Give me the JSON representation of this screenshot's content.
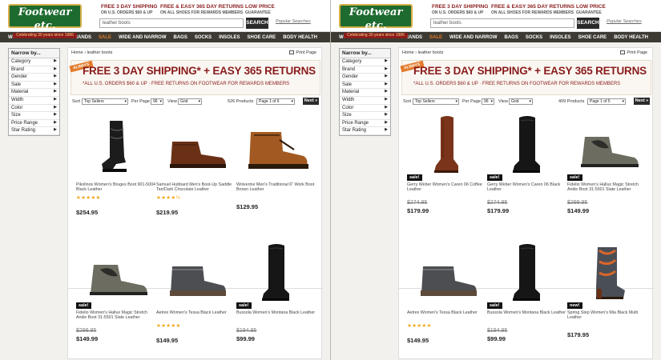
{
  "header": {
    "logo_text": "Footwear etc.",
    "logo_tagline": "Celebrating 30 years since 1986",
    "promos": [
      {
        "line1": "FREE 3 DAY SHIPPING",
        "line2": "ON U.S. ORDERS $60 & UP"
      },
      {
        "line1": "FREE & EASY 365 DAY RETURNS",
        "line2": "ON ALL SHOES FOR REWARDS MEMBERS"
      },
      {
        "line1": "LOW PRICE",
        "line2": "GUARANTEE"
      }
    ],
    "search_value": "leather boots",
    "search_button": "SEARCH",
    "popular_searches": "Popular Searches"
  },
  "nav": [
    "WOMEN",
    "MEN",
    "KIDS",
    "BRANDS",
    "SALE",
    "WIDE AND NARROW",
    "BAGS",
    "SOCKS",
    "INSOLES",
    "SHOE CARE",
    "BODY HEALTH"
  ],
  "sidebar": {
    "heading": "Narrow by...",
    "items": [
      "Category",
      "Brand",
      "Gender",
      "Sale",
      "Material",
      "Width",
      "Color",
      "Size",
      "Price Range",
      "Star Rating"
    ]
  },
  "crumbs": {
    "home": "Home",
    "current": "leather boots",
    "print": "Print Page"
  },
  "banner": {
    "badge": "ALWAYS",
    "main": "FREE 3 DAY SHIPPING* + EASY 365 RETURNS",
    "sub": "*ALL U.S. ORDERS $60 & UP · FREE RETURNS ON FOOTWEAR FOR REWARDS MEMBERS"
  },
  "sort_labels": {
    "sort": "Sort",
    "per_page": "Per Page",
    "view": "View",
    "next": "Next »"
  },
  "left": {
    "sort": "Top Sellers",
    "per_page": "96",
    "view": "Grid",
    "count": "526 Products",
    "page": "Page 1 of 6",
    "products": [
      {
        "name": "Pikolinos Women's Bruges Boot 901-5004 Black Leather",
        "stars": "★★★★★",
        "price": "$254.95",
        "was": "",
        "badge": "",
        "shoe": "tall-black"
      },
      {
        "name": "Samuel Hubbard Men's Boot-Up Saddle Tan/Dark Chocolate Leather",
        "stars": "★★★★½",
        "price": "$219.95",
        "was": "",
        "badge": "",
        "shoe": "chukka-brown"
      },
      {
        "name": "Wolverine Men's Traditional 6\" Work Boot Brown Leather",
        "stars": "",
        "price": "$129.95",
        "was": "",
        "badge": "",
        "shoe": "work-brown"
      },
      {
        "name": "Fidelio Women's Hallux Magic Stretch Ankle Boot 31-5501 Slate Leather",
        "stars": "",
        "price": "$149.99",
        "was": "$299.95",
        "badge": "sale!",
        "shoe": "ankle-slate"
      },
      {
        "name": "Aetrex Women's Tessa Black Leather",
        "stars": "★★★★★",
        "price": "$149.95",
        "was": "",
        "badge": "",
        "shoe": "ankle-grey"
      },
      {
        "name": "Bussola Women's Montana Black Leather",
        "stars": "",
        "price": "$99.99",
        "was": "$194.95",
        "badge": "sale!",
        "shoe": "tall-plain"
      }
    ]
  },
  "right": {
    "sort": "Top Sellers",
    "per_page": "96",
    "view": "Grid",
    "count": "409 Products",
    "page": "Page 1 of 5",
    "products": [
      {
        "name": "Gerry Weber Women's Caren 06 Coffee Leather",
        "stars": "",
        "price": "$179.99",
        "was": "$274.95",
        "badge": "sale!",
        "shoe": "tall-cognac"
      },
      {
        "name": "Gerry Weber Women's Caren 06 Black Leather",
        "stars": "",
        "price": "$179.99",
        "was": "$274.95",
        "badge": "sale!",
        "shoe": "tall-plain"
      },
      {
        "name": "Fidelio Women's Hallux Magic Stretch Ankle Boot 31-5501 Slate Leather",
        "stars": "",
        "price": "$149.99",
        "was": "$299.95",
        "badge": "sale!",
        "shoe": "ankle-slate"
      },
      {
        "name": "Aetrex Women's Tessa Black Leather",
        "stars": "★★★★★",
        "price": "$149.95",
        "was": "",
        "badge": "",
        "shoe": "ankle-grey"
      },
      {
        "name": "Bussola Women's Montana Black Leather",
        "stars": "",
        "price": "$99.99",
        "was": "$194.95",
        "badge": "sale!",
        "shoe": "tall-plain"
      },
      {
        "name": "Spring Step Women's Mia Black Multi Leather",
        "stars": "",
        "price": "$179.95",
        "was": "",
        "badge": "new!",
        "shoe": "floral"
      }
    ]
  },
  "colors": {
    "brand_green": "#1e6b2f",
    "brand_red": "#8a1c1c",
    "nav_bg": "#3d3a33",
    "sale_orange": "#e07a2a"
  }
}
